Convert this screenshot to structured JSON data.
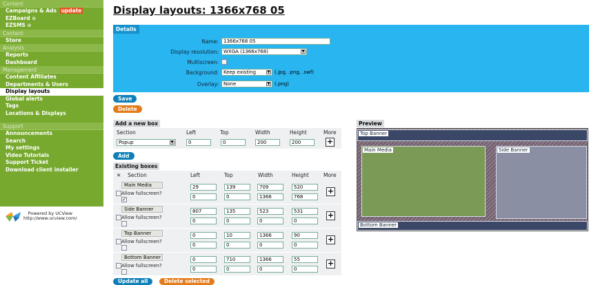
{
  "sidebar": {
    "content_head": "Content",
    "campaigns": "Campaigns & Ads",
    "update_badge": "update",
    "ezboard": "EZBoard",
    "ezsms": "EZSMS",
    "circle": "⊙",
    "content_head2": "Content",
    "store": "Store",
    "analysis_head": "Analysis",
    "reports": "Reports",
    "dashboard": "Dashboard",
    "management_head": "Management",
    "content_affiliates": "Content Affiliates",
    "departments_users": "Departments & Users",
    "display_layouts": "Display layouts",
    "global_alerts": "Global alerts",
    "tags": "Tags",
    "locations_displays": "Locations & Displays",
    "support_head": "Support",
    "announcements": "Announcements",
    "search": "Search",
    "my_settings": "My settings",
    "video_tutorials": "Video Tutorials",
    "support_ticket": "Support Ticket",
    "download_client": "Download client installer",
    "powered_line1": "Powered by UCView",
    "powered_line2": "http://www.ucview.com/"
  },
  "page_title": "Display layouts: 1366x768 05",
  "details": {
    "tab": "Details",
    "name_label": "Name:",
    "name_value": "1366x768 05",
    "resolution_label": "Display resolution:",
    "resolution_value": "WXGA (1366x768)",
    "multiscreen_label": "Multiscreen:",
    "background_label": "Background:",
    "background_value": "Keep existing",
    "background_hint": "(.jpg, .png, .swf)",
    "overlay_label": "Overlay:",
    "overlay_value": "None",
    "overlay_hint": "(.png)",
    "arrow": "▼"
  },
  "buttons": {
    "save": "Save",
    "delete": "Delete",
    "add": "Add",
    "update_all": "Update all",
    "delete_selected": "Delete selected",
    "plus": "+"
  },
  "add_box": {
    "tab": "Add a new box",
    "headers": {
      "section": "Section",
      "left": "Left",
      "top": "Top",
      "width": "Width",
      "height": "Height",
      "more": "More"
    },
    "section": "Popup",
    "left": "0",
    "top": "0",
    "width": "200",
    "height": "200"
  },
  "existing": {
    "tab": "Existing boxes",
    "headers": {
      "x": "✕",
      "section": "Section",
      "left": "Left",
      "top": "Top",
      "width": "Width",
      "height": "Height",
      "more": "More"
    },
    "allow_fullscreen": "Allow fullscreen?",
    "check": "✓",
    "rows": [
      {
        "section": "Main Media",
        "left": "29",
        "top": "139",
        "width": "709",
        "height": "520",
        "left2": "0",
        "top2": "0",
        "width2": "1366",
        "height2": "768",
        "fullscreen": true
      },
      {
        "section": "Side Banner",
        "left": "807",
        "top": "135",
        "width": "523",
        "height": "531",
        "left2": "0",
        "top2": "0",
        "width2": "0",
        "height2": "0",
        "fullscreen": false
      },
      {
        "section": "Top Banner",
        "left": "0",
        "top": "10",
        "width": "1366",
        "height": "90",
        "left2": "0",
        "top2": "0",
        "width2": "0",
        "height2": "0",
        "fullscreen": false
      },
      {
        "section": "Bottom Banner",
        "left": "0",
        "top": "710",
        "width": "1366",
        "height": "55",
        "left2": "0",
        "top2": "0",
        "width2": "0",
        "height2": "0",
        "fullscreen": false
      }
    ]
  },
  "preview": {
    "tab": "Preview",
    "top_banner": "Top Banner",
    "main_media": "Main Media",
    "side_banner": "Side Banner",
    "bottom_banner": "Bottom Banner",
    "main_media_color": "#7a9a55",
    "side_banner_color": "#8a8fa3",
    "banner_color": "#3b4766"
  }
}
